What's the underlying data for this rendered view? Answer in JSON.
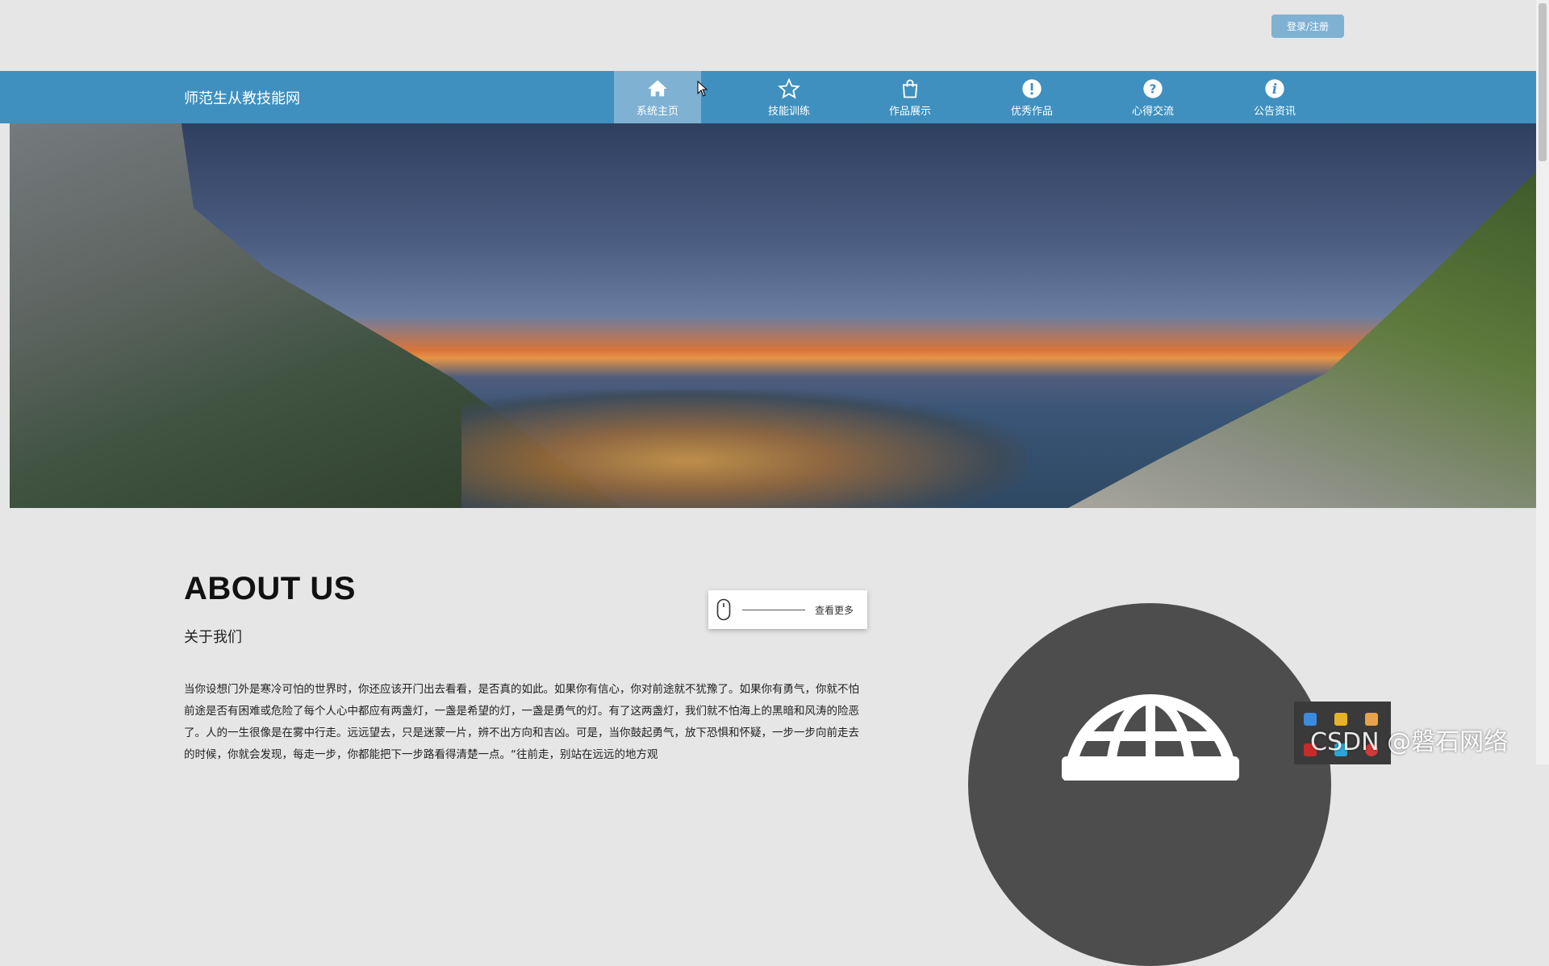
{
  "header": {
    "login_label": "登录/注册"
  },
  "navbar": {
    "brand": "师范生从教技能网",
    "items": [
      {
        "label": "系统主页",
        "icon": "home-icon",
        "active": true
      },
      {
        "label": "技能训练",
        "icon": "star-icon",
        "active": false
      },
      {
        "label": "作品展示",
        "icon": "shopping-bag-icon",
        "active": false
      },
      {
        "label": "优秀作品",
        "icon": "exclamation-circle-icon",
        "active": false
      },
      {
        "label": "心得交流",
        "icon": "question-circle-icon",
        "active": false
      },
      {
        "label": "公告资讯",
        "icon": "info-circle-icon",
        "active": false
      }
    ]
  },
  "carousel": {
    "slide_count": 3,
    "active_index": 1
  },
  "about": {
    "title": "ABOUT US",
    "subtitle": "关于我们",
    "text": "当你设想门外是寒冷可怕的世界时，你还应该开门出去看看，是否真的如此。如果你有信心，你对前途就不犹豫了。如果你有勇气，你就不怕前途是否有困难或危险了每个人心中都应有两盏灯，一盏是希望的灯，一盏是勇气的灯。有了这两盏灯，我们就不怕海上的黑暗和风涛的险恶了。人的一生很像是在雾中行走。远远望去，只是迷蒙一片，辨不出方向和吉凶。可是，当你鼓起勇气，放下恐惧和怀疑，一步一步向前走去的时候，你就会发现，每走一步，你都能把下一步路看得清楚一点。“往前走，别站在远远的地方观",
    "more_label": "查看更多"
  },
  "watermark": "CSDN @磐石网络",
  "colors": {
    "nav_bg": "#3f90bf",
    "nav_active": "#7fb1d3",
    "page_bg": "#e6e6e6"
  }
}
